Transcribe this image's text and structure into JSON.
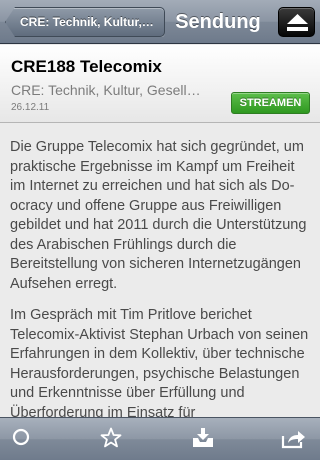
{
  "navbar": {
    "back_label": "CRE: Technik, Kultur,…",
    "title": "Sendung",
    "right_icon": "eject-icon"
  },
  "episode": {
    "title": "CRE188 Telecomix",
    "podcast": "CRE: Technik, Kultur, Gesell…",
    "date": "26.12.11",
    "stream_label": "STREAMEN",
    "stream_color": "#3fa72c"
  },
  "description": {
    "paragraphs": [
      "Die Gruppe Telecomix hat sich gegründet, um praktische Ergebnisse im Kampf um Freiheit im Internet zu erreichen und hat sich als Do-ocracy und offene Gruppe aus Freiwilligen gebildet und hat 2011 durch die Unterstützung des Arabischen Frühlings durch die Bereitstellung von sicheren Internetzugängen Aufsehen erregt.",
      "Im Gespräch mit Tim Pritlove berichet Telecomix-Aktivist Stephan Urbach von seinen Erfahrungen in dem Kollektiv, über technische Herausforderungen, psychische Belastungen und Erkenntnisse über Erfüllung und Überforderung im Einsatz für"
    ]
  },
  "toolbar": {
    "icons": [
      "circle-icon",
      "star-icon",
      "download-tray-icon",
      "share-arrow-icon"
    ]
  }
}
